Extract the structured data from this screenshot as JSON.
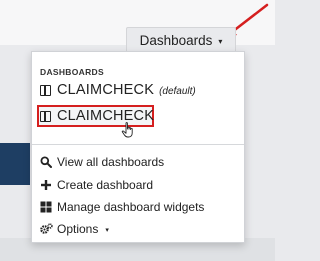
{
  "toolbar": {
    "dashboards_button_label": "Dashboards",
    "dashboards_caret": "▾"
  },
  "menu": {
    "section_header": "DASHBOARDS",
    "dashboards": [
      {
        "name": "CLAIMCHECK",
        "tag": "(default)",
        "icon": "dashboard-icon"
      },
      {
        "name": "CLAIMCHECK",
        "tag": "",
        "icon": "dashboard-icon"
      }
    ],
    "actions": [
      {
        "label": "View all dashboards",
        "icon": "search-icon"
      },
      {
        "label": "Create dashboard",
        "icon": "plus-icon"
      },
      {
        "label": "Manage dashboard widgets",
        "icon": "widgets-icon"
      },
      {
        "label": "Options",
        "icon": "gear-icon",
        "caret": "▾"
      }
    ]
  },
  "annotation": {
    "arrow_color": "#d51f1f",
    "highlight_color": "#d51f1f"
  }
}
